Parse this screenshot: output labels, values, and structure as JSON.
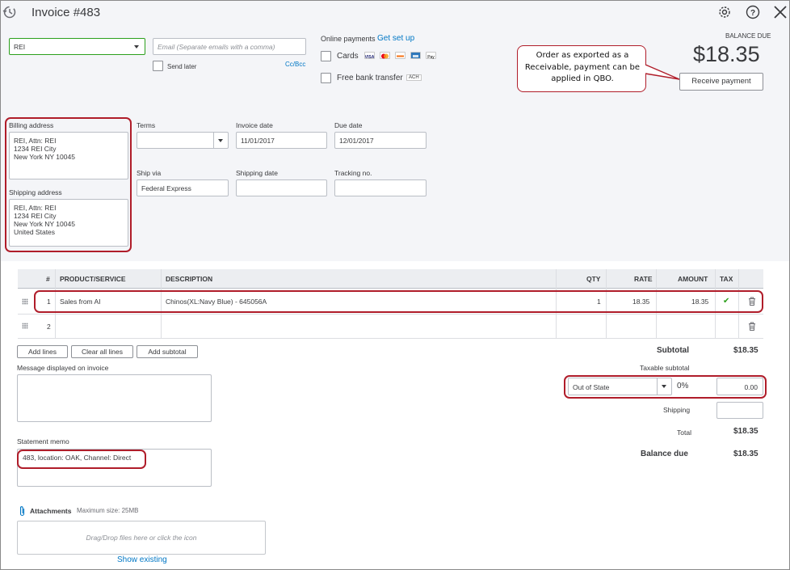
{
  "header": {
    "title": "Invoice #483"
  },
  "customer": {
    "value": "REI"
  },
  "email": {
    "placeholder": "Email (Separate emails with a comma)",
    "send_later": "Send later",
    "cc_bcc": "Cc/Bcc"
  },
  "payments": {
    "label": "Online payments",
    "setup": "Get set up",
    "cards": "Cards",
    "bank": "Free bank transfer",
    "ach": "ACH",
    "card_brands": [
      "VISA",
      "MC",
      "DISC",
      "AMEX",
      "Pay"
    ]
  },
  "balance": {
    "label": "BALANCE DUE",
    "amount": "$18.35",
    "receive": "Receive payment"
  },
  "callout": {
    "text": "Order as exported as a Receivable, payment can be applied in QBO."
  },
  "billing": {
    "label": "Billing address",
    "lines": [
      "REI, Attn: REI",
      "1234 REI City",
      "New York NY 10045"
    ]
  },
  "shipping_addr": {
    "label": "Shipping address",
    "lines": [
      "REI, Attn: REI",
      "1234 REI City",
      "New York NY 10045",
      "United States"
    ]
  },
  "terms": {
    "label": "Terms",
    "value": ""
  },
  "invoice_date": {
    "label": "Invoice date",
    "value": "11/01/2017"
  },
  "due_date": {
    "label": "Due date",
    "value": "12/01/2017"
  },
  "ship_via": {
    "label": "Ship via",
    "value": "Federal Express"
  },
  "shipping_date": {
    "label": "Shipping date",
    "value": ""
  },
  "tracking": {
    "label": "Tracking no.",
    "value": ""
  },
  "table": {
    "headers": {
      "num": "#",
      "product": "PRODUCT/SERVICE",
      "desc": "DESCRIPTION",
      "qty": "QTY",
      "rate": "RATE",
      "amount": "AMOUNT",
      "tax": "TAX"
    },
    "rows": [
      {
        "num": "1",
        "product": "Sales from AI",
        "desc": "Chinos(XL:Navy Blue)  - 645056A",
        "qty": "1",
        "rate": "18.35",
        "amount": "18.35",
        "tax": "✔"
      },
      {
        "num": "2",
        "product": "",
        "desc": "",
        "qty": "",
        "rate": "",
        "amount": "",
        "tax": ""
      }
    ]
  },
  "actions": {
    "add_lines": "Add lines",
    "clear_lines": "Clear all lines",
    "add_subtotal": "Add subtotal"
  },
  "message": {
    "label": "Message displayed on invoice",
    "value": ""
  },
  "memo": {
    "label": "Statement memo",
    "value": "483, location: OAK, Channel: Direct"
  },
  "attachments": {
    "label": "Attachments",
    "max": "Maximum size: 25MB",
    "drop": "Drag/Drop files here or click the icon",
    "show": "Show existing"
  },
  "totals": {
    "subtotal_label": "Subtotal",
    "subtotal": "$18.35",
    "taxable_label": "Taxable subtotal",
    "tax_rate": "Out of State",
    "tax_pct": "0%",
    "tax_amount": "0.00",
    "shipping_label": "Shipping",
    "total_label": "Total",
    "total": "$18.35",
    "balance_label": "Balance due",
    "balance": "$18.35"
  },
  "colors": {
    "accent": "#0077c5",
    "annotation": "#b01d2a",
    "check": "#2ca01c"
  }
}
